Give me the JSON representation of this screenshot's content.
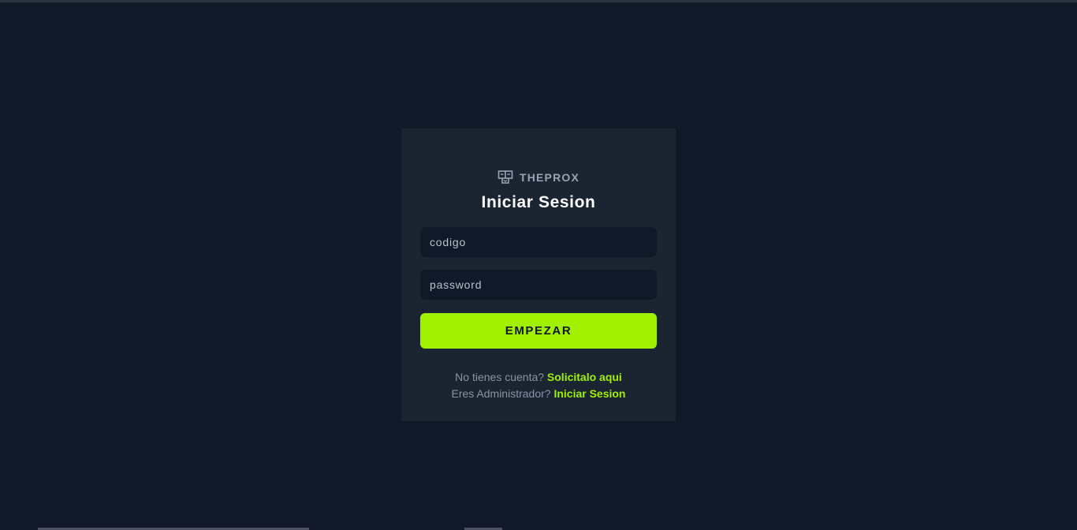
{
  "brand": {
    "name": "THEPROX",
    "icon": "logo-icon"
  },
  "login": {
    "title": "Iniciar Sesion",
    "code_placeholder": "codigo",
    "code_value": "",
    "password_placeholder": "password",
    "password_value": "",
    "submit_label": "EMPEZAR"
  },
  "links": {
    "no_account_text": "No tienes cuenta?",
    "request_link": "Solicitalo aqui",
    "admin_text": "Eres Administrador?",
    "admin_link": "Iniciar Sesion"
  },
  "colors": {
    "background": "#111827",
    "card": "#1b2431",
    "accent": "#a0f000",
    "muted_text": "#8c93a3"
  }
}
